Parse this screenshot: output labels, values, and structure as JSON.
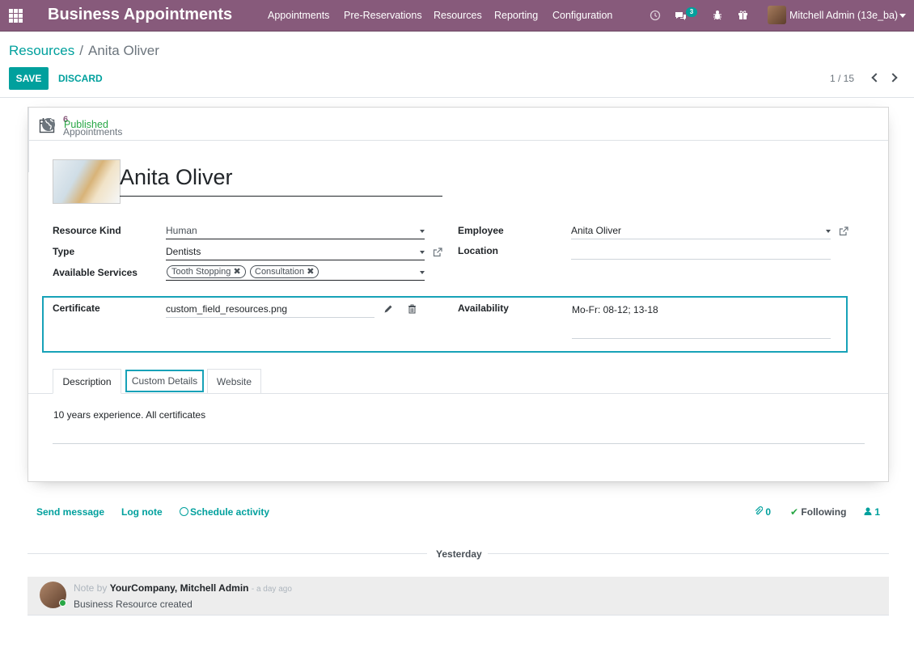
{
  "navbar": {
    "brand": "Business Appointments",
    "menu": [
      "Appointments",
      "Pre-Reservations",
      "Resources",
      "Reporting",
      "Configuration"
    ],
    "messages_count": "3",
    "user": "Mitchell Admin (13e_ba)"
  },
  "control_panel": {
    "breadcrumb_parent": "Resources",
    "breadcrumb_sep": "/",
    "breadcrumb_current": "Anita Oliver",
    "save": "SAVE",
    "discard": "DISCARD",
    "pager": "1 / 15"
  },
  "stat_buttons": {
    "appointments_count": "6",
    "appointments_label": "Appointments",
    "published_label": "Published"
  },
  "form": {
    "name": "Anita Oliver",
    "resource_kind_label": "Resource Kind",
    "resource_kind_value": "Human",
    "type_label": "Type",
    "type_value": "Dentists",
    "services_label": "Available Services",
    "services": [
      "Tooth Stopping",
      "Consultation"
    ],
    "employee_label": "Employee",
    "employee_value": "Anita Oliver",
    "location_label": "Location",
    "location_value": "",
    "certificate_label": "Certificate",
    "certificate_value": "custom_field_resources.png",
    "availability_label": "Availability",
    "availability_value": "Mo-Fr: 08-12; 13-18"
  },
  "tabs": [
    "Description",
    "Custom Details",
    "Website"
  ],
  "description": "10 years experience. All certificates",
  "chatter": {
    "send_message": "Send message",
    "log_note": "Log note",
    "schedule_activity": "Schedule activity",
    "attachments_count": "0",
    "following": "Following",
    "followers_count": "1",
    "date_separator": "Yesterday",
    "note_prefix": "Note by",
    "author": "YourCompany, Mitchell Admin",
    "time": "- a day ago",
    "body": "Business Resource created"
  },
  "colors": {
    "brand": "#875a7b",
    "accent": "#00a09d",
    "highlight": "#17a2b8",
    "published": "#28a745"
  }
}
